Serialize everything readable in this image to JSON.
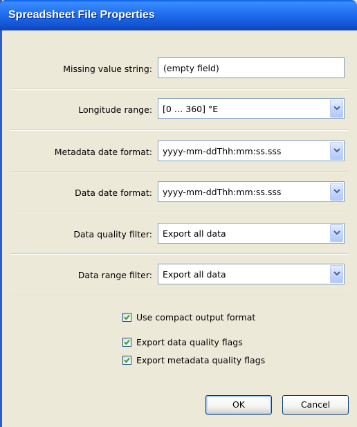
{
  "window": {
    "title": "Spreadsheet File Properties"
  },
  "fields": {
    "missing_value": {
      "label": "Missing value string:",
      "value": "(empty field)"
    },
    "longitude_range": {
      "label": "Longitude range:",
      "value": "[0 … 360] °E"
    },
    "metadata_date_format": {
      "label": "Metadata date format:",
      "value": "yyyy-mm-ddThh:mm:ss.sss"
    },
    "data_date_format": {
      "label": "Data date format:",
      "value": "yyyy-mm-ddThh:mm:ss.sss"
    },
    "data_quality_filter": {
      "label": "Data quality filter:",
      "value": "Export all data"
    },
    "data_range_filter": {
      "label": "Data range filter:",
      "value": "Export all data"
    }
  },
  "options": {
    "compact_output": {
      "label": "Use compact output format",
      "checked": true
    },
    "export_data_quality_flags": {
      "label": "Export data quality flags",
      "checked": true
    },
    "export_metadata_quality_flags": {
      "label": "Export metadata quality flags",
      "checked": true
    }
  },
  "buttons": {
    "ok": "OK",
    "cancel": "Cancel"
  },
  "colors": {
    "titlebar": "#1f6ff0",
    "dialog_bg": "#ece9d8",
    "check_mark": "#21a121"
  }
}
